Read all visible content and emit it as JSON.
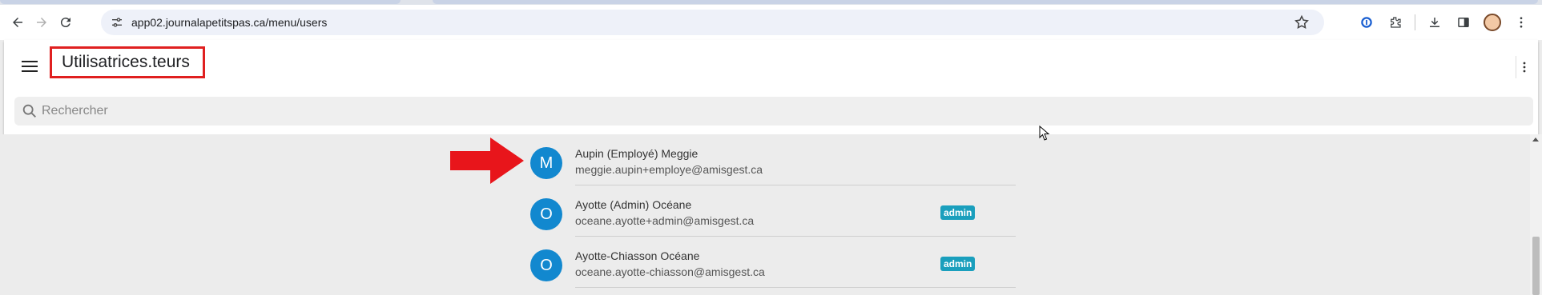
{
  "browser": {
    "url": "app02.journalapetitspas.ca/menu/users"
  },
  "header": {
    "title": "Utilisatrices.teurs",
    "menu_icon": "hamburger-menu-icon",
    "overflow_icon": "more-vertical-icon"
  },
  "search": {
    "placeholder": "Rechercher",
    "value": ""
  },
  "users": [
    {
      "initial": "M",
      "name": "Aupin (Employé) Meggie",
      "email": "meggie.aupin+employe@amisgest.ca",
      "badge": ""
    },
    {
      "initial": "O",
      "name": "Ayotte (Admin) Océane",
      "email": "oceane.ayotte+admin@amisgest.ca",
      "badge": "admin"
    },
    {
      "initial": "O",
      "name": "Ayotte-Chiasson Océane",
      "email": "oceane.ayotte-chiasson@amisgest.ca",
      "badge": "admin"
    }
  ],
  "colors": {
    "highlight": "#e02020",
    "avatar": "#1288cf",
    "badge": "#1a9fbd"
  }
}
